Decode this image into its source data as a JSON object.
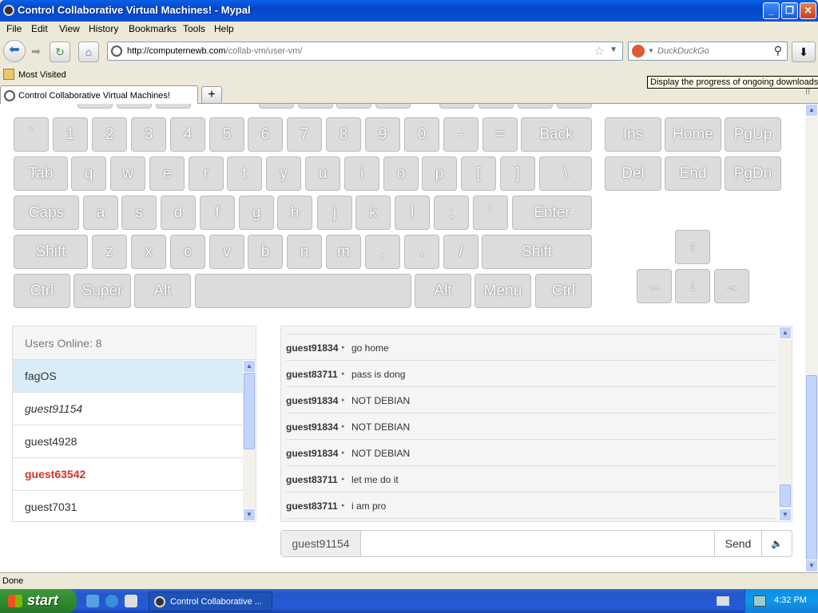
{
  "window": {
    "title": "Control Collaborative Virtual Machines! - Mypal"
  },
  "menu": [
    "File",
    "Edit",
    "View",
    "History",
    "Bookmarks",
    "Tools",
    "Help"
  ],
  "nav": {
    "url_host": "http://computernewb.com",
    "url_path": "/collab-vm/user-vm/",
    "search_placeholder": "DuckDuckGo"
  },
  "bookmarks": {
    "most_visited": "Most Visited"
  },
  "tooltip": "Display the progress of ongoing downloads",
  "tab": {
    "title": "Control Collaborative Virtual Machines!"
  },
  "keyboard": {
    "row1": [
      "`",
      "1",
      "2",
      "3",
      "4",
      "5",
      "6",
      "7",
      "8",
      "9",
      "0",
      "-",
      "=",
      "Back"
    ],
    "row2": [
      "Tab",
      "q",
      "w",
      "e",
      "r",
      "t",
      "y",
      "u",
      "i",
      "o",
      "p",
      "[",
      "]",
      "\\"
    ],
    "row3": [
      "Caps",
      "a",
      "s",
      "d",
      "f",
      "g",
      "h",
      "j",
      "k",
      "l",
      ";",
      "'",
      "Enter"
    ],
    "row4": [
      "Shift",
      "z",
      "x",
      "c",
      "v",
      "b",
      "n",
      "m",
      ",",
      ".",
      "/",
      "Shift"
    ],
    "row5": [
      "Ctrl",
      "Super",
      "Alt",
      "",
      "Alt",
      "Menu",
      "Ctrl"
    ],
    "nav1": [
      "Ins",
      "Home",
      "PgUp"
    ],
    "nav2": [
      "Del",
      "End",
      "PgDn"
    ],
    "arrows": {
      "up": "↑",
      "left": "←",
      "down": "↓",
      "right": "→"
    }
  },
  "users": {
    "header": "Users Online: 8",
    "list": [
      "fagOS",
      "guest91154",
      "guest4928",
      "guest63542",
      "guest7031"
    ]
  },
  "chat": {
    "messages": [
      {
        "user": "guest91834",
        "text": "go home"
      },
      {
        "user": "guest83711",
        "text": "pass is dong"
      },
      {
        "user": "guest91834",
        "text": "NOT DEBIAN"
      },
      {
        "user": "guest91834",
        "text": "NOT DEBIAN"
      },
      {
        "user": "guest91834",
        "text": "NOT DEBIAN"
      },
      {
        "user": "guest83711",
        "text": "let me do it"
      },
      {
        "user": "guest83711",
        "text": "i am pro"
      }
    ],
    "username": "guest91154",
    "send": "Send"
  },
  "status": "Done",
  "taskbar": {
    "start": "start",
    "item": "Control Collaborative ...",
    "time": "4:32 PM"
  }
}
